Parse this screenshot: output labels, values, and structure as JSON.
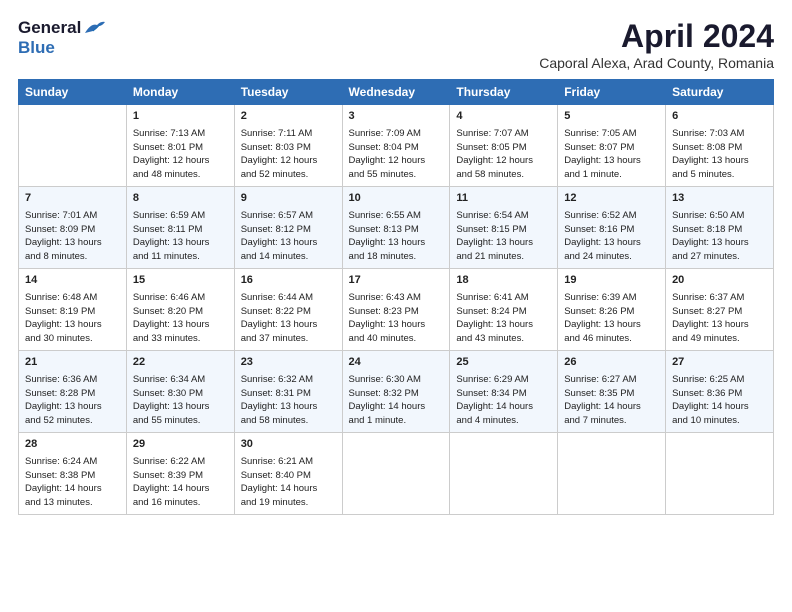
{
  "header": {
    "logo_general": "General",
    "logo_blue": "Blue",
    "title": "April 2024",
    "subtitle": "Caporal Alexa, Arad County, Romania"
  },
  "days_of_week": [
    "Sunday",
    "Monday",
    "Tuesday",
    "Wednesday",
    "Thursday",
    "Friday",
    "Saturday"
  ],
  "weeks": [
    [
      {
        "day": "",
        "info": ""
      },
      {
        "day": "1",
        "info": "Sunrise: 7:13 AM\nSunset: 8:01 PM\nDaylight: 12 hours\nand 48 minutes."
      },
      {
        "day": "2",
        "info": "Sunrise: 7:11 AM\nSunset: 8:03 PM\nDaylight: 12 hours\nand 52 minutes."
      },
      {
        "day": "3",
        "info": "Sunrise: 7:09 AM\nSunset: 8:04 PM\nDaylight: 12 hours\nand 55 minutes."
      },
      {
        "day": "4",
        "info": "Sunrise: 7:07 AM\nSunset: 8:05 PM\nDaylight: 12 hours\nand 58 minutes."
      },
      {
        "day": "5",
        "info": "Sunrise: 7:05 AM\nSunset: 8:07 PM\nDaylight: 13 hours\nand 1 minute."
      },
      {
        "day": "6",
        "info": "Sunrise: 7:03 AM\nSunset: 8:08 PM\nDaylight: 13 hours\nand 5 minutes."
      }
    ],
    [
      {
        "day": "7",
        "info": "Sunrise: 7:01 AM\nSunset: 8:09 PM\nDaylight: 13 hours\nand 8 minutes."
      },
      {
        "day": "8",
        "info": "Sunrise: 6:59 AM\nSunset: 8:11 PM\nDaylight: 13 hours\nand 11 minutes."
      },
      {
        "day": "9",
        "info": "Sunrise: 6:57 AM\nSunset: 8:12 PM\nDaylight: 13 hours\nand 14 minutes."
      },
      {
        "day": "10",
        "info": "Sunrise: 6:55 AM\nSunset: 8:13 PM\nDaylight: 13 hours\nand 18 minutes."
      },
      {
        "day": "11",
        "info": "Sunrise: 6:54 AM\nSunset: 8:15 PM\nDaylight: 13 hours\nand 21 minutes."
      },
      {
        "day": "12",
        "info": "Sunrise: 6:52 AM\nSunset: 8:16 PM\nDaylight: 13 hours\nand 24 minutes."
      },
      {
        "day": "13",
        "info": "Sunrise: 6:50 AM\nSunset: 8:18 PM\nDaylight: 13 hours\nand 27 minutes."
      }
    ],
    [
      {
        "day": "14",
        "info": "Sunrise: 6:48 AM\nSunset: 8:19 PM\nDaylight: 13 hours\nand 30 minutes."
      },
      {
        "day": "15",
        "info": "Sunrise: 6:46 AM\nSunset: 8:20 PM\nDaylight: 13 hours\nand 33 minutes."
      },
      {
        "day": "16",
        "info": "Sunrise: 6:44 AM\nSunset: 8:22 PM\nDaylight: 13 hours\nand 37 minutes."
      },
      {
        "day": "17",
        "info": "Sunrise: 6:43 AM\nSunset: 8:23 PM\nDaylight: 13 hours\nand 40 minutes."
      },
      {
        "day": "18",
        "info": "Sunrise: 6:41 AM\nSunset: 8:24 PM\nDaylight: 13 hours\nand 43 minutes."
      },
      {
        "day": "19",
        "info": "Sunrise: 6:39 AM\nSunset: 8:26 PM\nDaylight: 13 hours\nand 46 minutes."
      },
      {
        "day": "20",
        "info": "Sunrise: 6:37 AM\nSunset: 8:27 PM\nDaylight: 13 hours\nand 49 minutes."
      }
    ],
    [
      {
        "day": "21",
        "info": "Sunrise: 6:36 AM\nSunset: 8:28 PM\nDaylight: 13 hours\nand 52 minutes."
      },
      {
        "day": "22",
        "info": "Sunrise: 6:34 AM\nSunset: 8:30 PM\nDaylight: 13 hours\nand 55 minutes."
      },
      {
        "day": "23",
        "info": "Sunrise: 6:32 AM\nSunset: 8:31 PM\nDaylight: 13 hours\nand 58 minutes."
      },
      {
        "day": "24",
        "info": "Sunrise: 6:30 AM\nSunset: 8:32 PM\nDaylight: 14 hours\nand 1 minute."
      },
      {
        "day": "25",
        "info": "Sunrise: 6:29 AM\nSunset: 8:34 PM\nDaylight: 14 hours\nand 4 minutes."
      },
      {
        "day": "26",
        "info": "Sunrise: 6:27 AM\nSunset: 8:35 PM\nDaylight: 14 hours\nand 7 minutes."
      },
      {
        "day": "27",
        "info": "Sunrise: 6:25 AM\nSunset: 8:36 PM\nDaylight: 14 hours\nand 10 minutes."
      }
    ],
    [
      {
        "day": "28",
        "info": "Sunrise: 6:24 AM\nSunset: 8:38 PM\nDaylight: 14 hours\nand 13 minutes."
      },
      {
        "day": "29",
        "info": "Sunrise: 6:22 AM\nSunset: 8:39 PM\nDaylight: 14 hours\nand 16 minutes."
      },
      {
        "day": "30",
        "info": "Sunrise: 6:21 AM\nSunset: 8:40 PM\nDaylight: 14 hours\nand 19 minutes."
      },
      {
        "day": "",
        "info": ""
      },
      {
        "day": "",
        "info": ""
      },
      {
        "day": "",
        "info": ""
      },
      {
        "day": "",
        "info": ""
      }
    ]
  ]
}
